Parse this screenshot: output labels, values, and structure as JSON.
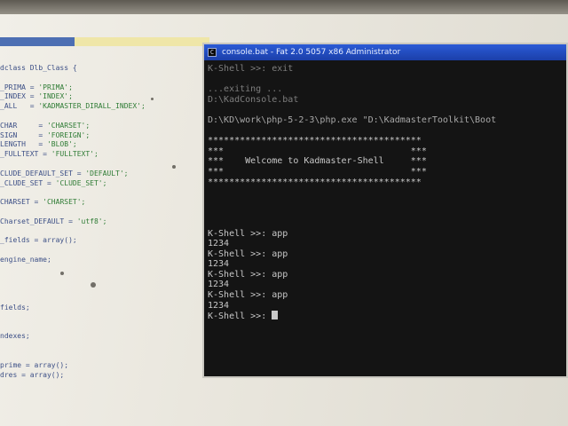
{
  "console": {
    "title": "console.bat - Fat 2.0 5057 x86 Administrator",
    "output_lines": [
      {
        "text": "K-Shell >>: exit",
        "tone": "dim"
      },
      {
        "text": "",
        "tone": "gap"
      },
      {
        "text": "...exiting ...",
        "tone": "dim"
      },
      {
        "text": "D:\\KadConsole.bat",
        "tone": "dim"
      },
      {
        "text": "",
        "tone": "gap"
      },
      {
        "text": "D:\\KD\\work\\php-5-2-3\\php.exe \"D:\\KadmasterToolkit\\Boot",
        "tone": "mid"
      },
      {
        "text": "",
        "tone": "gap"
      },
      {
        "text": "****************************************",
        "tone": "normal"
      },
      {
        "text": "***                                   ***",
        "tone": "normal"
      },
      {
        "text": "***    Welcome to Kadmaster-Shell     ***",
        "tone": "normal"
      },
      {
        "text": "***                                   ***",
        "tone": "normal"
      },
      {
        "text": "****************************************",
        "tone": "normal"
      },
      {
        "text": "",
        "tone": "gap"
      },
      {
        "text": "",
        "tone": "gap"
      },
      {
        "text": "",
        "tone": "gap"
      },
      {
        "text": "",
        "tone": "gap"
      },
      {
        "text": "K-Shell >>: app",
        "tone": "normal"
      },
      {
        "text": "1234",
        "tone": "normal"
      },
      {
        "text": "K-Shell >>: app",
        "tone": "normal"
      },
      {
        "text": "1234",
        "tone": "normal"
      },
      {
        "text": "K-Shell >>: app",
        "tone": "normal"
      },
      {
        "text": "1234",
        "tone": "normal"
      },
      {
        "text": "K-Shell >>: app",
        "tone": "normal"
      },
      {
        "text": "1234",
        "tone": "normal"
      }
    ],
    "prompt": "K-Shell >>: "
  },
  "editor": {
    "tab_label": "",
    "lines": [
      {
        "code": "dclass Dlb_Class {",
        "str": ""
      },
      {
        "code": "",
        "str": ""
      },
      {
        "code": "_PRIMA = ",
        "str": "'PRIMA';"
      },
      {
        "code": "_INDEX = ",
        "str": "'INDEX';"
      },
      {
        "code": "_ALL   = ",
        "str": "'KADMASTER_DIRALL_INDEX';"
      },
      {
        "code": "",
        "str": ""
      },
      {
        "code": "CHAR     = ",
        "str": "'CHARSET';"
      },
      {
        "code": "SIGN     = ",
        "str": "'FOREIGN';"
      },
      {
        "code": "LENGTH   = ",
        "str": "'BLOB';"
      },
      {
        "code": "_FULLTEXT = ",
        "str": "'FULLTEXT';"
      },
      {
        "code": "",
        "str": ""
      },
      {
        "code": "CLUDE_DEFAULT_SET = ",
        "str": "'DEFAULT';"
      },
      {
        "code": "_CLUDE_SET = ",
        "str": "'CLUDE_SET';"
      },
      {
        "code": "",
        "str": ""
      },
      {
        "code": "CHARSET = ",
        "str": "'CHARSET';"
      },
      {
        "code": "",
        "str": ""
      },
      {
        "code": "Charset_DEFAULT = ",
        "str": "'utf8';"
      },
      {
        "code": "",
        "str": ""
      },
      {
        "code": "_fields = array();",
        "str": ""
      },
      {
        "code": "",
        "str": ""
      },
      {
        "code": "engine_name;",
        "str": ""
      },
      {
        "code": "",
        "str": ""
      },
      {
        "code": "",
        "str": ""
      },
      {
        "code": "",
        "str": ""
      },
      {
        "code": "",
        "str": ""
      },
      {
        "code": "fields;",
        "str": ""
      },
      {
        "code": "",
        "str": ""
      },
      {
        "code": "",
        "str": ""
      },
      {
        "code": "ndexes;",
        "str": ""
      },
      {
        "code": "",
        "str": ""
      },
      {
        "code": "",
        "str": ""
      },
      {
        "code": "prime = array();",
        "str": ""
      },
      {
        "code": "dres = array();",
        "str": ""
      }
    ]
  }
}
